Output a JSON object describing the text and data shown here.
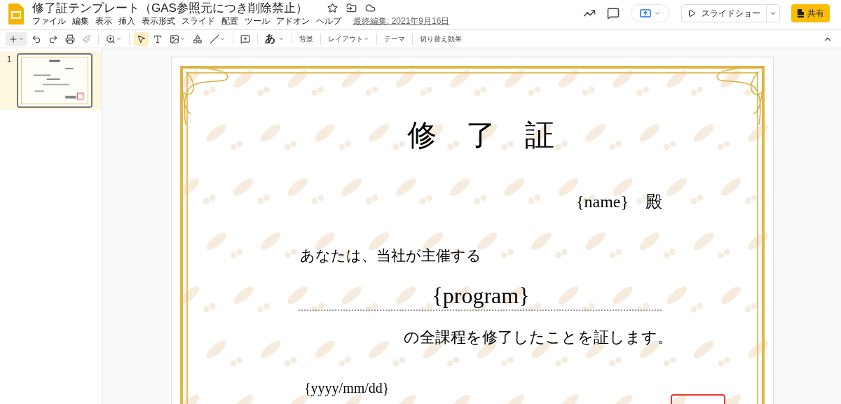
{
  "document": {
    "title": "修了証テンプレート（GAS参照元につき削除禁止）",
    "last_edit": "最終編集: 2021年9月16日"
  },
  "menu": [
    "ファイル",
    "編集",
    "表示",
    "挿入",
    "表示形式",
    "スライド",
    "配置",
    "ツール",
    "アドオン",
    "ヘルプ"
  ],
  "header_buttons": {
    "slideshow": "スライドショー",
    "share": "共有"
  },
  "toolbar_texts": [
    "あ",
    "背景",
    "レイアウト",
    "テーマ",
    "切り替え効果"
  ],
  "slides": [
    {
      "number": "1",
      "selected": true
    }
  ],
  "slide": {
    "title": "修　了　証",
    "recipient": "{name}　殿",
    "line1": "あなたは、当社が主催する",
    "program": "{program}",
    "line2": "の全課程を修了したことを証します。",
    "date": "{yyyy/mm/dd}"
  }
}
